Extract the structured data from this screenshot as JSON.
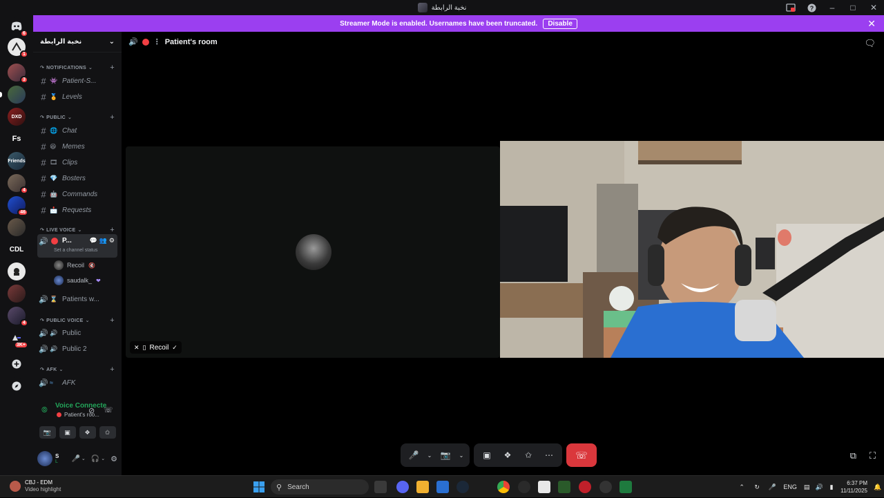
{
  "window": {
    "title": "نخبة الرابطة"
  },
  "banner": {
    "text": "Streamer Mode is enabled. Usernames have been truncated.",
    "disable_label": "Disable",
    "bg_color": "#9b3ff0"
  },
  "guilds": [
    {
      "label": "",
      "badge": "6",
      "icon": "discord-home-icon"
    },
    {
      "label": "",
      "badge": "1"
    },
    {
      "label": "",
      "badge": "3"
    },
    {
      "label": "",
      "badge": ""
    },
    {
      "label": "",
      "badge": ""
    },
    {
      "label": "Fs",
      "badge": ""
    },
    {
      "label": "Friends",
      "badge": ""
    },
    {
      "label": "",
      "badge": "4"
    },
    {
      "label": "",
      "badge": "46"
    },
    {
      "label": "",
      "badge": ""
    },
    {
      "label": "CDL",
      "badge": ""
    },
    {
      "label": "",
      "badge": ""
    },
    {
      "label": "",
      "badge": ""
    },
    {
      "label": "",
      "badge": "4"
    },
    {
      "label": "",
      "badge": "3K+"
    }
  ],
  "sidebar": {
    "server_name": "نخبة الرابطة",
    "categories": {
      "notifications": "NOTIFICATIONS",
      "public": "PUBLIC",
      "live_voice": "LIVE VOICE",
      "public_voice": "PUBLIC VOICE",
      "afk": "AFK"
    },
    "notifications_channels": [
      "Patient-S...",
      "Levels"
    ],
    "public_channels": [
      "Chat",
      "Memes",
      "Clips",
      "Bosters",
      "Commands",
      "Requests"
    ],
    "live_voice": {
      "active_channel": "P...",
      "status_hint": "Set a channel status",
      "members": [
        "Recoil",
        "saudalk_"
      ],
      "other_channel": "Patients w..."
    },
    "public_voice_channels": [
      "Public",
      "Public 2"
    ],
    "afk_channels": [
      "AFK"
    ],
    "voice_panel": {
      "status": "Voice Connecte",
      "channel": "Patient's roo..."
    },
    "user_panel": {
      "name": "S",
      "sub": "L"
    }
  },
  "main": {
    "room_title": "Patient's room",
    "tile_label": "Recoil"
  },
  "taskbar": {
    "media_title": "CBJ - EDM",
    "media_sub": "Video highlight",
    "search_placeholder": "Search",
    "language": "ENG",
    "time": "6:37 PM",
    "date": "11/11/2025"
  }
}
